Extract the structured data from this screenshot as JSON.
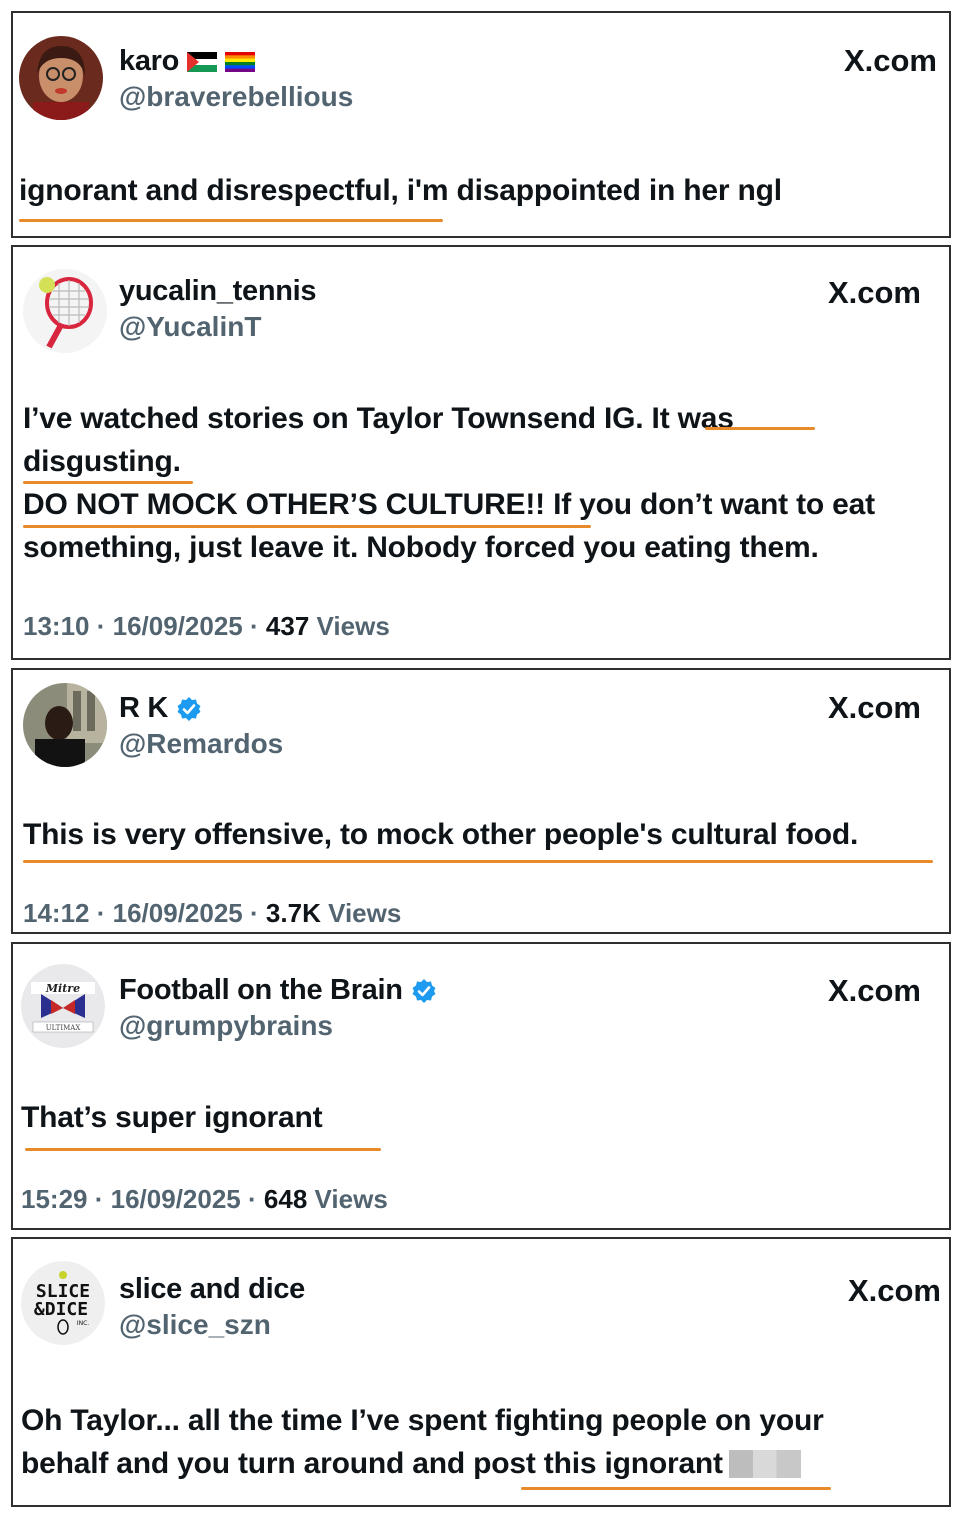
{
  "site_label": "X.com",
  "tweets": [
    {
      "display_name": "karo",
      "handle": "@braverebellious",
      "text_lines": [
        "ignorant and disrespectful, i'm disappointed in her ngl"
      ],
      "flags": [
        "palestine-flag-icon",
        "rainbow-flag-icon"
      ]
    },
    {
      "display_name": "yucalin_tennis",
      "handle": "@YucalinT",
      "text_lines": [
        "I’ve watched stories on Taylor Townsend IG. It was",
        "disgusting.",
        "DO NOT MOCK OTHER’S CULTURE!! If you don’t want to eat",
        "something, just leave it. Nobody forced you eating them."
      ],
      "time": "13:10",
      "date": "16/09/2025",
      "views_count": "437",
      "views_label": "Views"
    },
    {
      "display_name": "R K",
      "handle": "@Remardos",
      "verified": true,
      "text_lines": [
        "This is very offensive, to mock other people's cultural food."
      ],
      "time": "14:12",
      "date": "16/09/2025",
      "views_count": "3.7K",
      "views_label": "Views"
    },
    {
      "display_name": "Football on the Brain",
      "handle": "@grumpybrains",
      "verified": true,
      "text_lines": [
        "That’s super ignorant"
      ],
      "time": "15:29",
      "date": "16/09/2025",
      "views_count": "648",
      "views_label": "Views"
    },
    {
      "display_name": "slice and dice",
      "handle": "@slice_szn",
      "text_lines": [
        "Oh Taylor... all the time I’ve spent fighting people on your",
        "behalf and you turn around and post this ignorant"
      ],
      "avatar_text": [
        "SLICE",
        "&DICE",
        "INC."
      ]
    }
  ],
  "colors": {
    "underline": "#e8892a",
    "verified": "#1d9bf0",
    "handle": "#536471",
    "text": "#0f1419",
    "border": "#2f2f2f"
  }
}
